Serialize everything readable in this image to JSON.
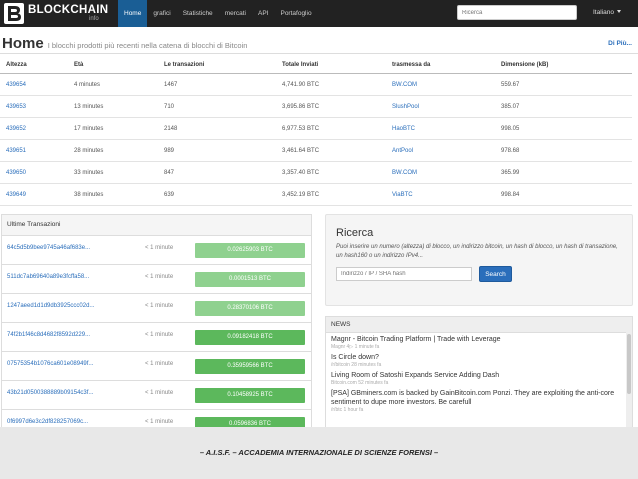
{
  "navbar": {
    "brand": "BLOCKCHAIN",
    "brand_sub": "info",
    "items": [
      {
        "label": "Home",
        "active": true
      },
      {
        "label": "grafici",
        "active": false
      },
      {
        "label": "Statistiche",
        "active": false
      },
      {
        "label": "mercati",
        "active": false
      },
      {
        "label": "API",
        "active": false
      },
      {
        "label": "Portafoglio",
        "active": false
      }
    ],
    "search_placeholder": "Ricerca",
    "language": "Italiano"
  },
  "page": {
    "title": "Home",
    "subtitle": "I blocchi prodotti più recenti nella catena di blocchi di Bitcoin",
    "more_link": "Di Più..."
  },
  "blocks_table": {
    "headers": [
      "Altezza",
      "Età",
      "Le transazioni",
      "Totale Inviati",
      "trasmessa da",
      "Dimensione (kB)"
    ],
    "rows": [
      {
        "height": "439654",
        "age": "4 minutes",
        "txs": "1467",
        "total": "4,741.90 BTC",
        "relayed": "BW.COM",
        "size": "559.67"
      },
      {
        "height": "439653",
        "age": "13 minutes",
        "txs": "710",
        "total": "3,695.86 BTC",
        "relayed": "SlushPool",
        "size": "385.07"
      },
      {
        "height": "439652",
        "age": "17 minutes",
        "txs": "2148",
        "total": "6,977.53 BTC",
        "relayed": "HaoBTC",
        "size": "998.05"
      },
      {
        "height": "439651",
        "age": "28 minutes",
        "txs": "989",
        "total": "3,461.64 BTC",
        "relayed": "AntPool",
        "size": "978.68"
      },
      {
        "height": "439650",
        "age": "33 minutes",
        "txs": "847",
        "total": "3,357.40 BTC",
        "relayed": "BW.COM",
        "size": "365.99"
      },
      {
        "height": "439649",
        "age": "38 minutes",
        "txs": "639",
        "total": "3,452.19 BTC",
        "relayed": "ViaBTC",
        "size": "998.84"
      }
    ]
  },
  "transactions": {
    "title": "Ultime Transazioni",
    "rows": [
      {
        "hash": "64c5d5b9bee9745a46af683e...",
        "time": "< 1 minute",
        "amount": "0.02625903 BTC",
        "shade": "light"
      },
      {
        "hash": "511dc7ab69640a89e3fcffa58...",
        "time": "< 1 minute",
        "amount": "0.0001513 BTC",
        "shade": "light"
      },
      {
        "hash": "1247aeed1d1d9db3925ccc02d...",
        "time": "< 1 minute",
        "amount": "0.28370106 BTC",
        "shade": "light"
      },
      {
        "hash": "74f2b1f46c8d4682f8592d229...",
        "time": "< 1 minute",
        "amount": "0.09182418 BTC",
        "shade": "dark"
      },
      {
        "hash": "07575354b1076ca601e08949f...",
        "time": "< 1 minute",
        "amount": "0.35959566 BTC",
        "shade": "dark"
      },
      {
        "hash": "43b21d0500388889b09154c3f...",
        "time": "< 1 minute",
        "amount": "0.10458925 BTC",
        "shade": "dark"
      },
      {
        "hash": "0f6997d6e3c2df828257069c...",
        "time": "< 1 minute",
        "amount": "0.0596836 BTC",
        "shade": "dark"
      }
    ]
  },
  "search_panel": {
    "title": "Ricerca",
    "description": "Puoi inserire un numero (altezza) di blocco, un indirizzo bitcoin, un hash di blocco, un hash di transazione, un hash160 o un indirizzo IPv4...",
    "input_placeholder": "Indirizzo / IP / SHA hash",
    "button": "Search"
  },
  "news": {
    "title": "NEWS",
    "items": [
      {
        "title": "Magnr - Bitcoin Trading Platform | Trade with Leverage",
        "meta": "Magnr 4▷ 1 minute fa"
      },
      {
        "title": "Is Circle down?",
        "meta": "/r/bitcoin 28 minutes fa"
      },
      {
        "title": "Living Room of Satoshi Expands Service Adding Dash",
        "meta": "Bitcoin.com 52 minutes fa"
      },
      {
        "title": "[PSA] GBminers.com is backed by GainBitcoin.com Ponzi. They are exploiting the anti-core sentiment to dupe more investors. Be carefull",
        "meta": "/r/btc 1 hour fa"
      }
    ]
  },
  "footer": {
    "text": "– A.I.S.F. – ACCADEMIA INTERNAZIONALE DI SCIENZE FORENSI –"
  },
  "colors": {
    "navbar_bg": "#222222",
    "active_nav": "#1a5e95",
    "link": "#2a6ebb",
    "amount_dark": "#5cb85c",
    "amount_light": "#8fd18f",
    "footer_bg": "#e8e8e8"
  },
  "icons": {
    "logo": "blockchain-logo-icon"
  }
}
